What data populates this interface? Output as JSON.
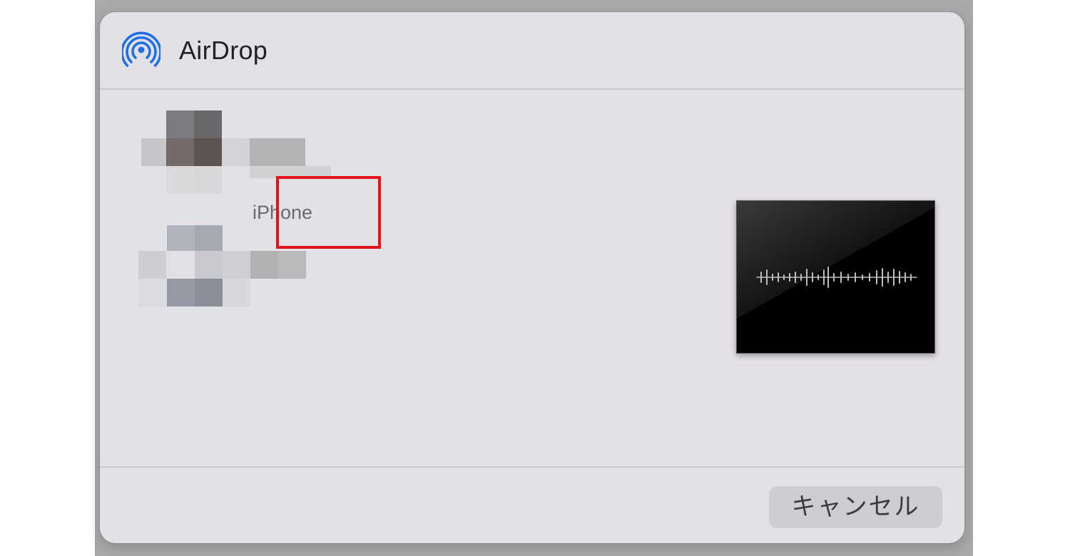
{
  "dialog": {
    "title": "AirDrop",
    "icon": "airdrop-icon",
    "accent_color": "#1f6fe5"
  },
  "devices": [
    {
      "label": "",
      "avatar": "pixelated-avatar"
    },
    {
      "label": "iPhone",
      "avatar": "pixelated-avatar",
      "highlighted": true,
      "highlight_color": "#e3131b"
    }
  ],
  "preview": {
    "type": "audio-waveform-thumbnail"
  },
  "footer": {
    "cancel_label": "キャンセル"
  }
}
